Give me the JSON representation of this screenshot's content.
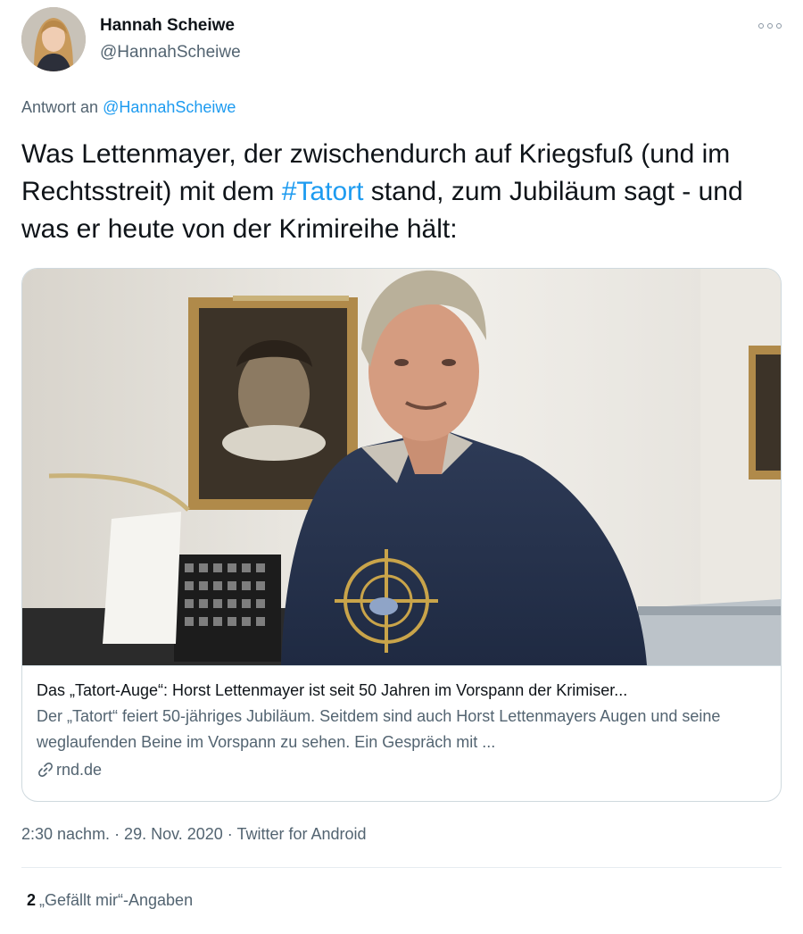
{
  "author": {
    "name": "Hannah Scheiwe",
    "handle": "@HannahScheiwe"
  },
  "reply": {
    "prefix": "Antwort an",
    "mention": "@HannahScheiwe"
  },
  "tweet": {
    "text_before": "Was Lettenmayer, der zwischendurch auf Kriegsfuß (und im Rechtsstreit) mit dem ",
    "hashtag": "#Tatort",
    "text_after": " stand, zum Jubiläum sagt - und was er heute von der Krimireihe hält:"
  },
  "card": {
    "title": "Das „Tatort-Auge“: Horst Lettenmayer ist seit 50 Jahren im Vorspann der Krimiser...",
    "description": "Der „Tatort“ feiert 50-jähriges Jubiläum. Seitdem sind auch Horst Lettenmayers Augen und seine weglaufenden Beine im Vorspann zu sehen. Ein Gespräch mit ...",
    "domain": "rnd.de",
    "domain_icon": "link-icon"
  },
  "meta": {
    "timestamp": "2:30 nachm. · 29. Nov. 2020 · Twitter for Android"
  },
  "stats": {
    "likes_count": "2",
    "likes_label": "„Gefällt mir“-Angaben"
  },
  "colors": {
    "link": "#1d9bf0",
    "secondary_text": "#536471",
    "border": "#cfd9de"
  }
}
